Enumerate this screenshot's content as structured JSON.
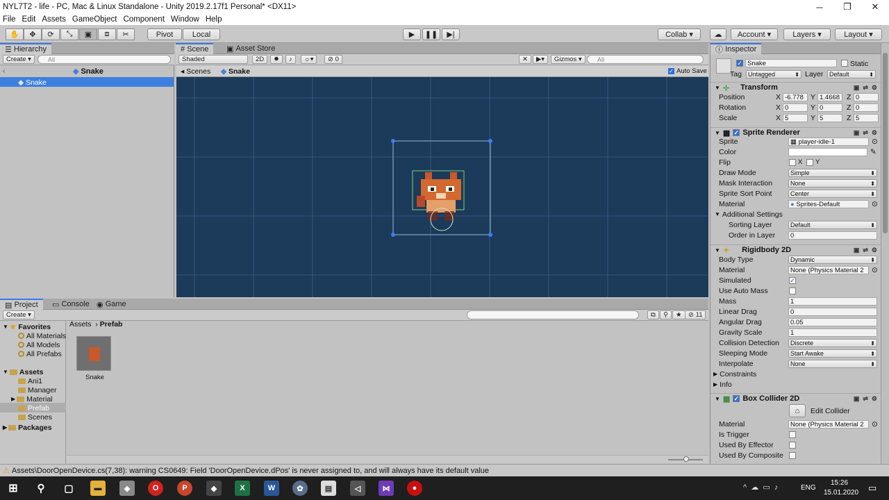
{
  "title_bar": {
    "title": "NYL7T2 - life - PC, Mac & Linux Standalone - Unity 2019.2.17f1 Personal* <DX11>",
    "minimize": "─",
    "maximize": "❐",
    "close": "✕"
  },
  "menu": [
    "File",
    "Edit",
    "Assets",
    "GameObject",
    "Component",
    "Window",
    "Help"
  ],
  "toolbar": {
    "pivot": "Pivot",
    "local": "Local",
    "collab": "Collab",
    "account": "Account",
    "layers": "Layers",
    "layout": "Layout"
  },
  "hierarchy": {
    "tab": "Hierarchy",
    "create": "Create",
    "search": "All",
    "scene_name": "Snake",
    "selected": "Snake"
  },
  "scene": {
    "tabs": [
      "Scene",
      "Asset Store"
    ],
    "shading": "Shaded",
    "mode_2d": "2D",
    "fx": "0",
    "gizmos": "Gizmos",
    "search": "All",
    "breadcrumb_root": "Scenes",
    "breadcrumb_item": "Snake",
    "auto_save": "Auto Save"
  },
  "inspector": {
    "tab": "Inspector",
    "object_name": "Snake",
    "static": "Static",
    "tag_label": "Tag",
    "tag_value": "Untagged",
    "layer_label": "Layer",
    "layer_value": "Default",
    "transform": {
      "title": "Transform",
      "position_label": "Position",
      "rotation_label": "Rotation",
      "scale_label": "Scale",
      "pos": [
        "-6.778",
        "1.4668",
        "0"
      ],
      "rot": [
        "0",
        "0",
        "0"
      ],
      "scl": [
        "5",
        "5",
        "5"
      ],
      "axis_x": "X",
      "axis_y": "Y",
      "axis_z": "Z"
    },
    "sprite_renderer": {
      "title": "Sprite Renderer",
      "sprite_label": "Sprite",
      "sprite": "player-idle-1",
      "color_label": "Color",
      "flip_label": "Flip",
      "flip_x": "X",
      "flip_y": "Y",
      "draw_mode_label": "Draw Mode",
      "draw_mode": "Simple",
      "mask_label": "Mask Interaction",
      "mask": "None",
      "sort_point_label": "Sprite Sort Point",
      "sort_point": "Center",
      "material_label": "Material",
      "material": "Sprites-Default",
      "additional": "Additional Settings",
      "sorting_layer_label": "Sorting Layer",
      "sorting_layer": "Default",
      "order_label": "Order in Layer",
      "order": "0"
    },
    "rigidbody": {
      "title": "Rigidbody 2D",
      "body_type_label": "Body Type",
      "body_type": "Dynamic",
      "material_label": "Material",
      "material": "None (Physics Material 2",
      "simulated_label": "Simulated",
      "auto_mass_label": "Use Auto Mass",
      "mass_label": "Mass",
      "mass": "1",
      "linear_label": "Linear Drag",
      "linear": "0",
      "angular_label": "Angular Drag",
      "angular": "0.05",
      "gravity_label": "Gravity Scale",
      "gravity": "1",
      "collision_label": "Collision Detection",
      "collision": "Discrete",
      "sleeping_label": "Sleeping Mode",
      "sleeping": "Start Awake",
      "interpolate_label": "Interpolate",
      "interpolate": "None",
      "constraints": "Constraints",
      "info": "Info"
    },
    "box_collider": {
      "title": "Box Collider 2D",
      "edit": "Edit Collider",
      "material_label": "Material",
      "material": "None (Physics Material 2",
      "trigger_label": "Is Trigger",
      "effector_label": "Used By Effector",
      "composite_label": "Used By Composite"
    }
  },
  "project": {
    "tabs": [
      "Project",
      "Console",
      "Game"
    ],
    "create": "Create",
    "favorites": "Favorites",
    "fav_items": [
      "All Materials",
      "All Models",
      "All Prefabs"
    ],
    "assets": "Assets",
    "asset_items": [
      "Ani1",
      "Manager",
      "Material",
      "Prefab",
      "Scenes"
    ],
    "packages": "Packages",
    "path_root": "Assets",
    "path_leaf": "Prefab",
    "item_name": "Snake",
    "count": "11"
  },
  "status": {
    "message": "Assets\\DoorOpenDevice.cs(7,38): warning CS0649: Field 'DoorOpenDevice.dPos' is never assigned to, and will always have its default value"
  },
  "taskbar": {
    "lang": "ENG",
    "time": "15:26",
    "date": "15.01.2020"
  }
}
